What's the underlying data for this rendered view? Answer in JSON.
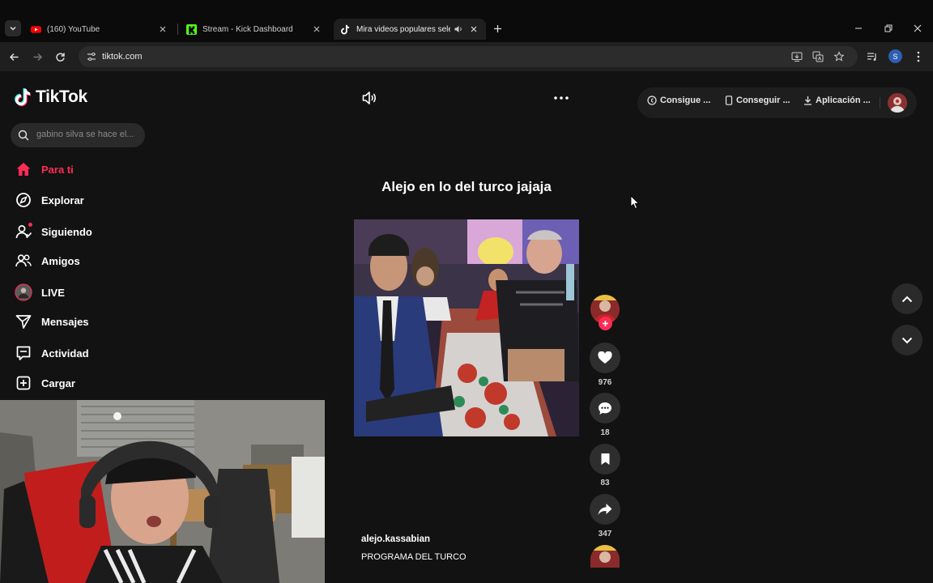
{
  "browser": {
    "tabs": [
      {
        "label": "(160) YouTube",
        "favicon": "youtube-icon",
        "active": false
      },
      {
        "label": "Stream - Kick Dashboard",
        "favicon": "kick-icon",
        "active": false
      },
      {
        "label": "Mira videos populares selec",
        "favicon": "tiktok-icon",
        "active": true
      }
    ],
    "url": "tiktok.com",
    "profile_initial": "S"
  },
  "sidebar": {
    "logo_text": "TikTok",
    "search_placeholder": "gabino silva se hace el...",
    "items": [
      {
        "label": "Para ti",
        "icon": "home-icon",
        "active": true
      },
      {
        "label": "Explorar",
        "icon": "compass-icon"
      },
      {
        "label": "Siguiendo",
        "icon": "following-icon"
      },
      {
        "label": "Amigos",
        "icon": "friends-icon"
      },
      {
        "label": "LIVE",
        "icon": "live-icon"
      },
      {
        "label": "Mensajes",
        "icon": "messages-icon"
      },
      {
        "label": "Actividad",
        "icon": "activity-icon"
      },
      {
        "label": "Cargar",
        "icon": "upload-icon"
      }
    ]
  },
  "topbar": {
    "coins": "Consigue ...",
    "app_get": "Conseguir ...",
    "app_download": "Aplicación ..."
  },
  "video": {
    "title": "Alejo en lo del turco jajaja",
    "author": "alejo.kassabian",
    "caption": "PROGRAMA DEL TURCO",
    "likes": "976",
    "comments": "18",
    "saves": "83",
    "shares": "347"
  },
  "colors": {
    "accent": "#fe2c55",
    "background": "#121212"
  }
}
